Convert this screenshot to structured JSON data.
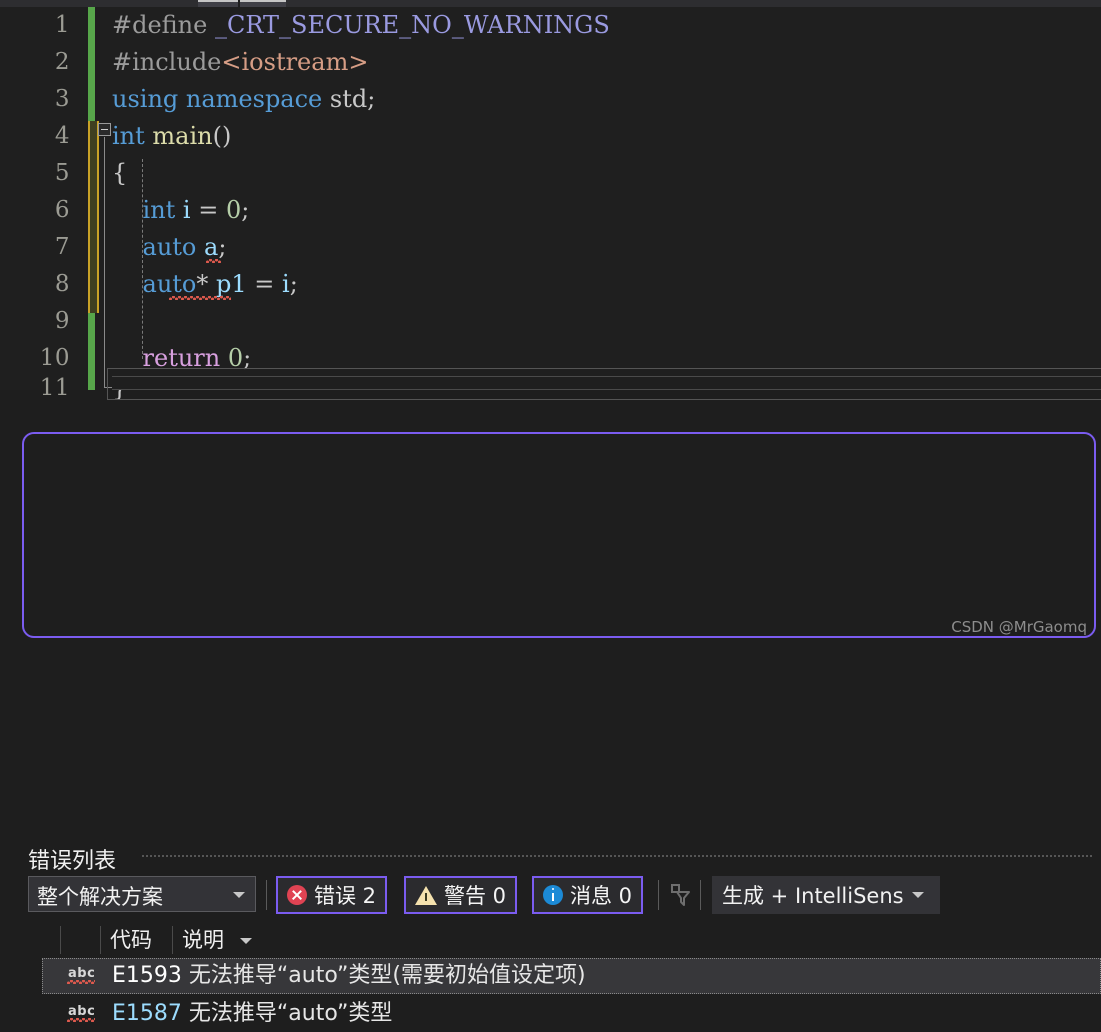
{
  "editor": {
    "line_numbers": [
      "1",
      "2",
      "3",
      "4",
      "5",
      "6",
      "7",
      "8",
      "9",
      "10",
      "11"
    ],
    "lines": [
      {
        "n": "1",
        "segments": [
          {
            "t": "#define ",
            "c": "gray"
          },
          {
            "t": "_CRT_SECURE_NO_WARNINGS",
            "c": "lav"
          }
        ]
      },
      {
        "n": "2",
        "segments": [
          {
            "t": "#include",
            "c": "gray"
          },
          {
            "t": "<iostream>",
            "c": "str"
          }
        ]
      },
      {
        "n": "3",
        "segments": [
          {
            "t": "using namespace ",
            "c": "blue"
          },
          {
            "t": "std;",
            "c": "id"
          }
        ]
      },
      {
        "n": "4",
        "segments": [
          {
            "t": "int ",
            "c": "blue"
          },
          {
            "t": "main",
            "c": "yellow"
          },
          {
            "t": "()",
            "c": "id"
          }
        ]
      },
      {
        "n": "5",
        "segments": [
          {
            "t": "{",
            "c": "id"
          }
        ]
      },
      {
        "n": "6",
        "segments": [
          {
            "t": "    int ",
            "c": "blue"
          },
          {
            "t": "i ",
            "c": "lightblue"
          },
          {
            "t": "= ",
            "c": "id"
          },
          {
            "t": "0",
            "c": "num"
          },
          {
            "t": ";",
            "c": "id"
          }
        ]
      },
      {
        "n": "7",
        "segments": [
          {
            "t": "    auto ",
            "c": "blue"
          },
          {
            "t": "a",
            "c": "lightblue"
          },
          {
            "t": ";",
            "c": "id"
          }
        ]
      },
      {
        "n": "8",
        "segments": [
          {
            "t": "    auto",
            "c": "blue"
          },
          {
            "t": "* ",
            "c": "id"
          },
          {
            "t": "p1 ",
            "c": "lightblue"
          },
          {
            "t": "= ",
            "c": "id"
          },
          {
            "t": "i",
            "c": "lightblue"
          },
          {
            "t": ";",
            "c": "id"
          }
        ]
      },
      {
        "n": "9",
        "segments": [
          {
            "t": "",
            "c": "id"
          }
        ]
      },
      {
        "n": "10",
        "segments": [
          {
            "t": "    return ",
            "c": "pink"
          },
          {
            "t": "0",
            "c": "num"
          },
          {
            "t": ";",
            "c": "id"
          }
        ]
      },
      {
        "n": "11",
        "segments": [
          {
            "t": "}",
            "c": "id"
          }
        ]
      }
    ],
    "colors": {
      "background": "#1f1f1f",
      "keyword": "#569cd6",
      "preprocessor": "#9b9b9b",
      "string": "#d69d85",
      "macro": "#9a9ae0",
      "function": "#dcdcaa",
      "number": "#b5cea8",
      "control": "#d8a0df",
      "identifier": "#9cdcfe",
      "change_bar_saved": "#57a64a",
      "change_bar_unsaved": "#c9a227",
      "error_squiggle": "#e05a4e"
    }
  },
  "error_list": {
    "title": "错误列表",
    "scope_filter": {
      "selected": "整个解决方案",
      "chevron": "chevron-down-icon"
    },
    "badges": [
      {
        "id": "errors",
        "icon": "error-circle-icon",
        "label": "错误 2"
      },
      {
        "id": "warnings",
        "icon": "warning-triangle-icon",
        "label": "警告 0"
      },
      {
        "id": "messages",
        "icon": "info-circle-icon",
        "label": "消息 0"
      }
    ],
    "filter_icon": "filter-funnel-icon",
    "build_filter": {
      "selected": "生成 + IntelliSens",
      "chevron": "chevron-down-icon"
    },
    "columns": [
      {
        "key": "code",
        "label": "代码"
      },
      {
        "key": "description",
        "label": "说明",
        "sorted": "descending",
        "sort_icon": "sort-caret-down-icon"
      }
    ],
    "rows": [
      {
        "icon": "abc-squiggle-icon",
        "code": "E1593",
        "description": "无法推导“auto”类型(需要初始值设定项)",
        "selected": true
      },
      {
        "icon": "abc-squiggle-icon",
        "code": "E1587",
        "description": "无法推导“auto”类型",
        "selected": false
      }
    ],
    "annotation_color": "#7b5cf0"
  },
  "watermark": "CSDN @MrGaomq"
}
